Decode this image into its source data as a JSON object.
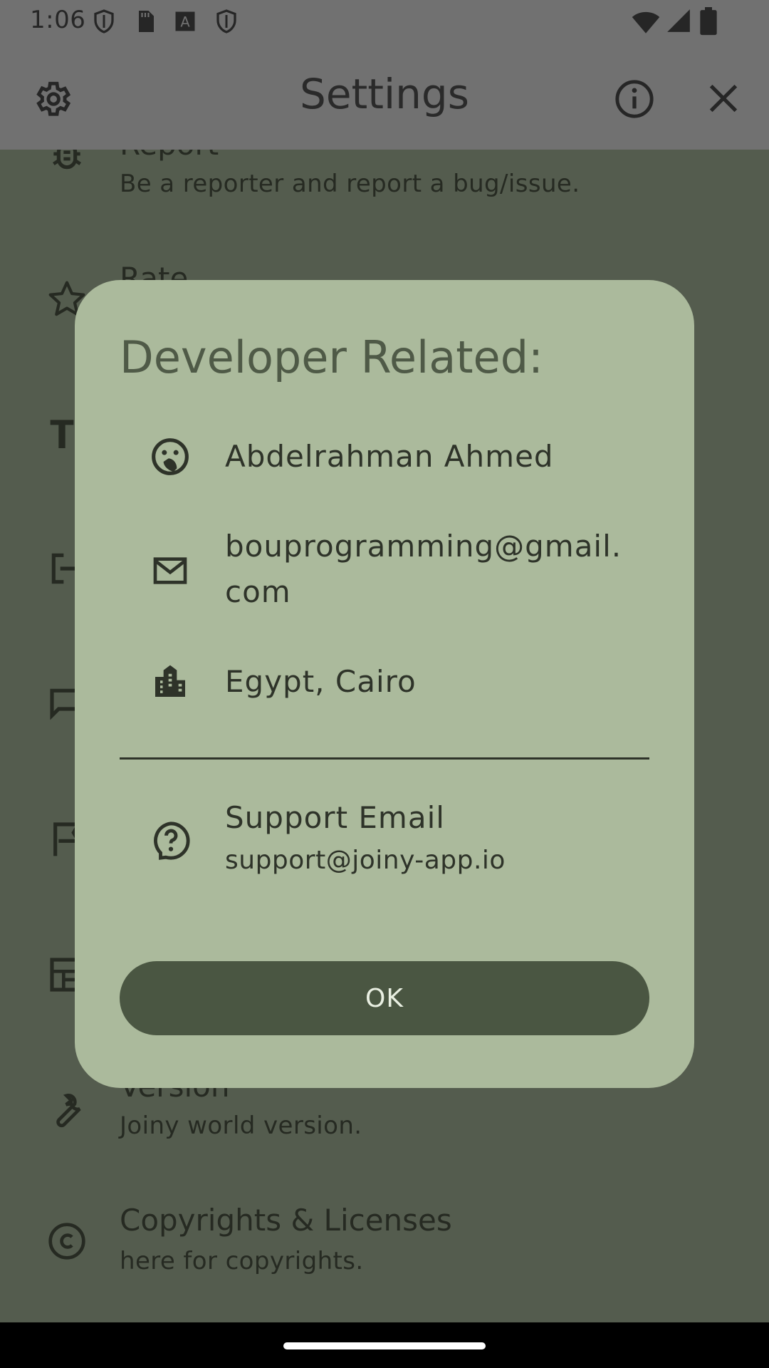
{
  "status_bar": {
    "time": "1:06",
    "icons": [
      "shield-icon",
      "sd-card-icon",
      "font-a-icon",
      "shield-icon",
      "wifi-icon",
      "signal-icon",
      "battery-icon"
    ]
  },
  "app_bar": {
    "title": "Settings",
    "icons": [
      "gear-icon",
      "info-icon",
      "close-icon"
    ]
  },
  "settings_list": {
    "items": [
      {
        "icon": "bug-icon",
        "title": "Report",
        "subtitle": "Be a reporter and report a bug/issue."
      },
      {
        "icon": "star-icon",
        "title": "Rate"
      },
      {
        "icon": "text-format-icon"
      },
      {
        "icon": "input-icon"
      },
      {
        "icon": "chat-icon"
      },
      {
        "icon": "flag-icon"
      },
      {
        "icon": "dashboard-icon"
      },
      {
        "icon": "wrench-icon",
        "title": "Version",
        "subtitle": "Joiny world version."
      },
      {
        "icon": "copyright-icon",
        "title": "Copyrights & Licenses",
        "subtitle": "here for copyrights."
      }
    ]
  },
  "dialog": {
    "title": "Developer Related:",
    "items": [
      {
        "icon": "face-icon",
        "text": "Abdelrahman Ahmed"
      },
      {
        "icon": "mail-icon",
        "text": "bouprogramming@gmail.com"
      },
      {
        "icon": "city-icon",
        "text": "Egypt, Cairo"
      }
    ],
    "support": {
      "icon": "help-icon",
      "title": "Support Email",
      "value": "support@joiny-app.io"
    },
    "ok_label": "OK"
  },
  "colors": {
    "scrim_bg": "#545c4e",
    "app_bar_bg": "#717171",
    "dialog_bg": "#abba9c",
    "button_bg": "#4a5642"
  }
}
